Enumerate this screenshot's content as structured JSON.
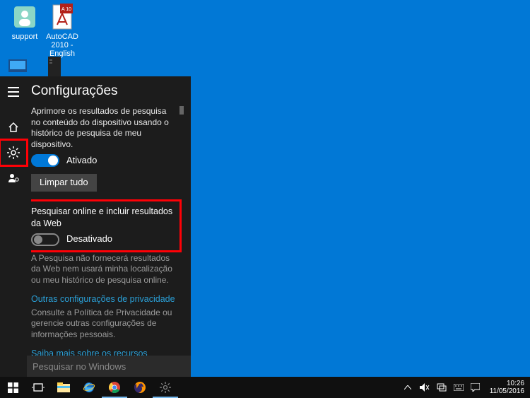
{
  "desktop": {
    "icons": [
      {
        "label": "support"
      },
      {
        "label": "AutoCAD 2010 - English"
      }
    ]
  },
  "search_panel": {
    "title": "Configurações",
    "improve_desc": "Aprimore os resultados de pesquisa no conteúdo do dispositivo usando o histórico de pesquisa de meu dispositivo.",
    "toggle_on_label": "Ativado",
    "clear_button": "Limpar tudo",
    "web_section_label": "Pesquisar online e incluir resultados da Web",
    "toggle_off_label": "Desativado",
    "web_desc": "A Pesquisa não fornecerá resultados da Web nem usará minha localização ou meu histórico de pesquisa online.",
    "privacy_link": "Outras configurações de privacidade",
    "privacy_desc": "Consulte a Política de Privacidade ou gerencie outras configurações de informações pessoais.",
    "cortana_link": "Saiba mais sobre os recursos Cortana e Pesquisar",
    "search_placeholder": "Pesquisar no Windows"
  },
  "taskbar": {
    "time": "10:26",
    "date": "11/05/2016"
  }
}
